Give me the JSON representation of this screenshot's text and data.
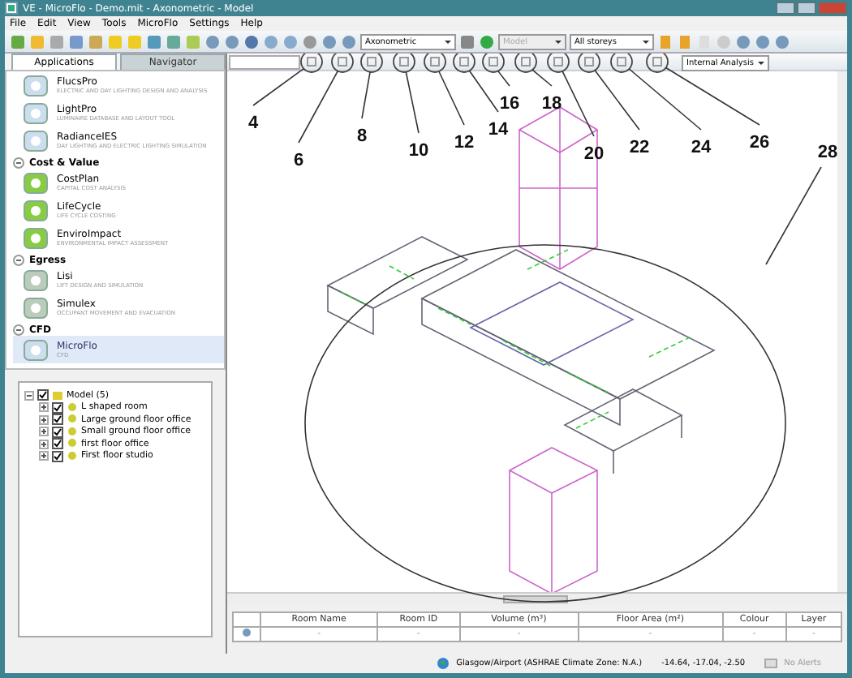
{
  "window": {
    "title": "VE - MicroFlo - Demo.mit - Axonometric - Model"
  },
  "menu": [
    "File",
    "Edit",
    "View",
    "Tools",
    "MicroFlo",
    "Settings",
    "Help"
  ],
  "toolbar": {
    "view_dropdown": "Axonometric",
    "mode_dropdown": {
      "value": "Model",
      "disabled": true
    },
    "storey_dropdown": "All storeys"
  },
  "tabs": [
    {
      "label": "Applications",
      "selected": true
    },
    {
      "label": "Navigator",
      "selected": false
    }
  ],
  "applications": [
    {
      "items": [
        {
          "name": "FlucsPro",
          "description": "ELECTRIC AND DAY LIGHTING DESIGN AND ANALYSIS",
          "selected": false
        },
        {
          "name": "LightPro",
          "description": "LUMINAIRE DATABASE AND LAYOUT TOOL",
          "selected": false
        },
        {
          "name": "RadianceIES",
          "description": "DAY LIGHTING AND ELECTRIC LIGHTING SIMULATION",
          "selected": false
        }
      ]
    },
    {
      "title": "Cost & Value",
      "items": [
        {
          "name": "CostPlan",
          "description": "CAPITAL COST ANALYSIS",
          "selected": false
        },
        {
          "name": "LifeCycle",
          "description": "LIFE CYCLE COSTING",
          "selected": false
        },
        {
          "name": "EnviroImpact",
          "description": "ENVIRONMENTAL IMPACT ASSESSMENT",
          "selected": false
        }
      ]
    },
    {
      "title": "Egress",
      "items": [
        {
          "name": "Lisi",
          "description": "LIFT DESIGN AND SIMULATION",
          "selected": false
        },
        {
          "name": "Simulex",
          "description": "OCCUPANT MOVEMENT AND EVACUATION",
          "selected": false
        }
      ]
    },
    {
      "title": "CFD",
      "items": [
        {
          "name": "MicroFlo",
          "description": "CFD",
          "selected": true
        }
      ]
    }
  ],
  "tree": [
    {
      "label": "Model (5)",
      "checked": true,
      "expanded": true,
      "children": [
        {
          "label": "L shaped room",
          "checked": true,
          "expanded": false
        },
        {
          "label": "Large ground floor office",
          "checked": true,
          "expanded": false
        },
        {
          "label": "Small ground floor office",
          "checked": true,
          "expanded": false
        },
        {
          "label": "first floor office",
          "checked": true,
          "expanded": false
        },
        {
          "label": "First floor studio",
          "checked": true,
          "expanded": false
        }
      ]
    }
  ],
  "analysis_dropdown": "Internal Analysis",
  "callouts": [
    "4",
    "6",
    "8",
    "10",
    "12",
    "14",
    "16",
    "18",
    "20",
    "22",
    "24",
    "26",
    "28"
  ],
  "table": {
    "columns": [
      "Room Name",
      "Room ID",
      "Volume (m³)",
      "Floor Area (m²)",
      "Colour",
      "Layer"
    ],
    "rows": [
      [
        "-",
        "-",
        "-",
        "-",
        "-",
        "-"
      ]
    ]
  },
  "status_bar": {
    "location": "Glasgow/Airport (ASHRAE Climate Zone: N.A.)",
    "coordinates": "-14.64, -17.04, -2.50",
    "alerts": "No Alerts"
  }
}
